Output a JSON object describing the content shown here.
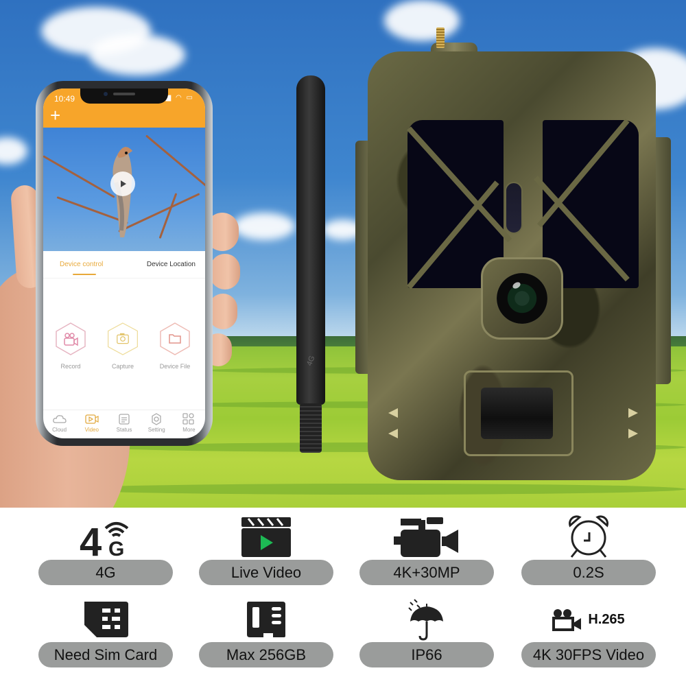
{
  "phone_app": {
    "status_bar": {
      "time": "10:49",
      "signal": "signal-bars-icon",
      "wifi": "wifi-icon",
      "battery": "battery-icon"
    },
    "header": {
      "add_icon": "plus-icon",
      "brand_color": "#f7a52a"
    },
    "video_preview": {
      "play_icon": "play-icon"
    },
    "tabs": [
      {
        "label": "Device control",
        "active": true
      },
      {
        "label": "Device Location",
        "active": false
      }
    ],
    "controls": [
      {
        "label": "Record",
        "icon": "video-camera-icon",
        "color": "#e0a0b0"
      },
      {
        "label": "Capture",
        "icon": "camera-icon",
        "color": "#e8d080"
      },
      {
        "label": "Device File",
        "icon": "folder-icon",
        "color": "#e8a8a0"
      }
    ],
    "bottom_nav": [
      {
        "label": "Cloud",
        "icon": "cloud-icon",
        "active": false
      },
      {
        "label": "Video",
        "icon": "video-icon",
        "active": true
      },
      {
        "label": "Status",
        "icon": "status-list-icon",
        "active": false
      },
      {
        "label": "Setting",
        "icon": "gear-icon",
        "active": false
      },
      {
        "label": "More",
        "icon": "grid-icon",
        "active": false
      }
    ]
  },
  "features": [
    {
      "label": "4G",
      "icon": "4g-signal-icon",
      "icon_text": "4",
      "icon_sub": "G"
    },
    {
      "label": "Live Video",
      "icon": "clapperboard-play-icon",
      "accent": "#1db954"
    },
    {
      "label": "4K+30MP",
      "icon": "camcorder-icon"
    },
    {
      "label": "0.2S",
      "icon": "alarm-clock-icon"
    },
    {
      "label": "Need Sim Card",
      "icon": "sim-card-icon"
    },
    {
      "label": "Max 256GB",
      "icon": "micro-sd-card-icon"
    },
    {
      "label": "IP66",
      "icon": "umbrella-rain-icon"
    },
    {
      "label": "4K 30FPS Video",
      "icon": "movie-camera-icon",
      "icon_text": "H.265"
    }
  ]
}
